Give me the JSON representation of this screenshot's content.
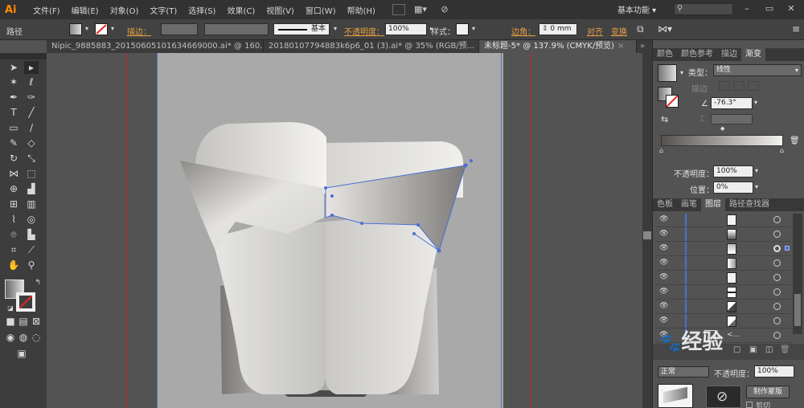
{
  "app": {
    "logo": "Ai"
  },
  "menu": [
    "文件(F)",
    "编辑(E)",
    "对象(O)",
    "文字(T)",
    "选择(S)",
    "效果(C)",
    "视图(V)",
    "窗口(W)",
    "帮助(H)"
  ],
  "workspace": {
    "label": "基本功能"
  },
  "control_bar": {
    "object_type": "路径",
    "stroke_label": "描边：",
    "stroke_style": "基本",
    "opacity_label": "不透明度：",
    "opacity_value": "100%",
    "style_label": "样式：",
    "corner_label": "边角：",
    "corner_value": "0 mm",
    "align_label": "对齐",
    "transform_label": "变换"
  },
  "tabs": [
    {
      "label": "Nipic_9885883_20150605101634669000.ai* @ 160.7...",
      "active": false
    },
    {
      "label": "20180107794883k6p6_01 (3).ai* @ 35% (RGB/预...",
      "active": false
    },
    {
      "label": "未标题-5* @ 137.9% (CMYK/预览)",
      "active": true
    }
  ],
  "panel_tabs_top": [
    {
      "label": "颜色",
      "active": false
    },
    {
      "label": "颜色参考",
      "active": false
    },
    {
      "label": "描边",
      "active": false
    },
    {
      "label": "渐变",
      "active": true
    }
  ],
  "gradient": {
    "type_label": "类型：",
    "type_value": "线性",
    "stroke_label": "描边",
    "angle_value": "-76.3°",
    "opacity_label": "不透明度：",
    "opacity_value": "100%",
    "position_label": "位置：",
    "position_value": "0%"
  },
  "panel_tabs_mid": [
    {
      "label": "色板",
      "active": false
    },
    {
      "label": "画笔",
      "active": false
    },
    {
      "label": "图层",
      "active": true
    },
    {
      "label": "路径查找器",
      "active": false
    }
  ],
  "layers": {
    "rows": 9,
    "last_row_label": "<...",
    "blend_mode": "正常",
    "opacity_label": "不透明度：",
    "opacity_value": "100%",
    "make_mask_label": "制作蒙版",
    "clip_label": "剪切"
  },
  "watermark": "经验",
  "colors": {
    "accent": "#e8a040",
    "selection": "#4a6fd4",
    "ai_orange": "#ff8a00"
  }
}
